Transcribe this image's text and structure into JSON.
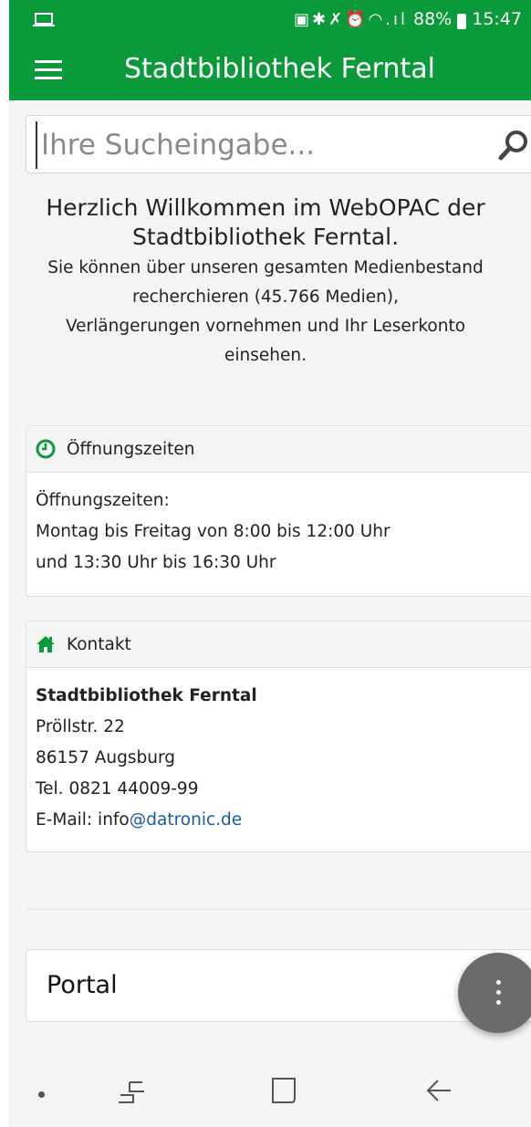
{
  "status_bar": {
    "battery_percent": "88%",
    "time": "15:47",
    "icons": [
      "laptop-icon",
      "data-saver-icon",
      "bluetooth-icon",
      "mute-icon",
      "alarm-icon",
      "wifi-icon",
      "signal-icon",
      "battery-icon"
    ]
  },
  "app_bar": {
    "title": "Stadtbibliothek Ferntal"
  },
  "search": {
    "placeholder": "Ihre Sucheingabe...",
    "value": ""
  },
  "welcome": {
    "heading_line1": "Herzlich Willkommen im WebOPAC der",
    "heading_line2": "Stadtbibliothek Ferntal.",
    "text_line1": "Sie können über unseren gesamten Medienbestand",
    "text_line2": "recherchieren (45.766 Medien),",
    "text_line3": "Verlängerungen vornehmen und Ihr Leserkonto",
    "text_line4": "einsehen."
  },
  "opening_hours": {
    "title": "Öffnungszeiten",
    "line1": "Öffnungszeiten:",
    "line2": "Montag bis Freitag von 8:00 bis 12:00 Uhr",
    "line3": "und 13:30 Uhr bis 16:30 Uhr"
  },
  "contact": {
    "title": "Kontakt",
    "name": "Stadtbibliothek Ferntal",
    "street": "Pröllstr. 22",
    "city": "86157 Augsburg",
    "phone": "Tel. 0821 44009-99",
    "email_prefix": "E-Mail: info",
    "email_link": "@datronic.de"
  },
  "portal": {
    "label": "Portal"
  },
  "colors": {
    "brand_green": "#0b9a3a",
    "link_blue": "#1a5aa8",
    "fab_grey": "#6b6b6b"
  }
}
